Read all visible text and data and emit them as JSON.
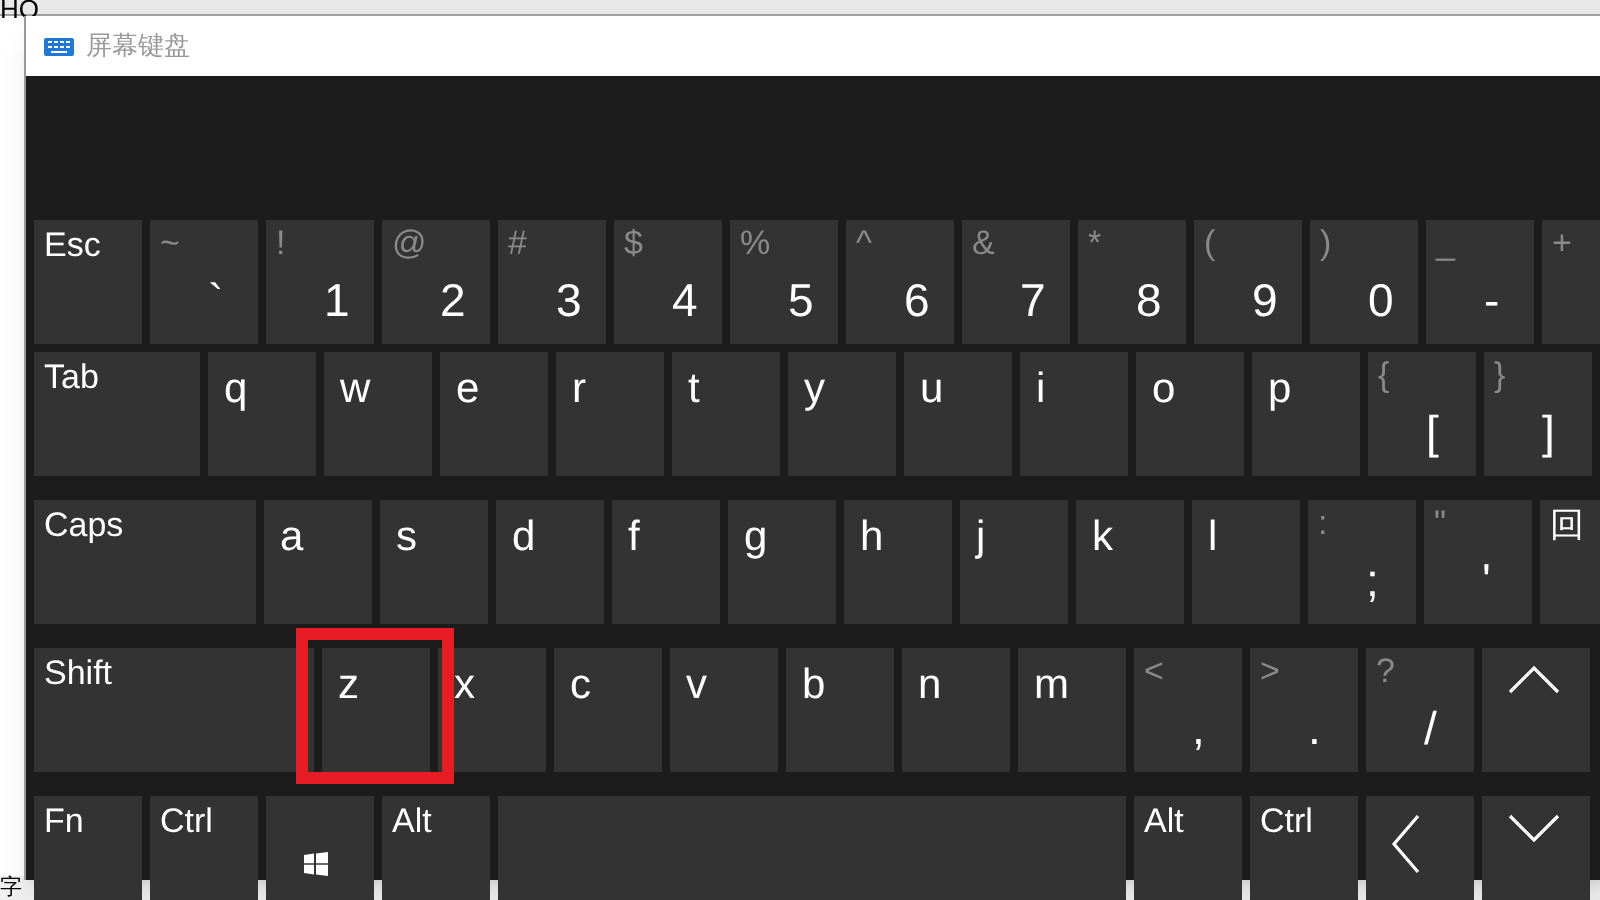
{
  "background": {
    "top_text": "HO",
    "bottom_text": "字"
  },
  "window": {
    "title": "屏幕键盘"
  },
  "rows": [
    {
      "keys": [
        {
          "kind": "mod",
          "label": "Esc"
        },
        {
          "kind": "char",
          "shift": "~",
          "main": "`"
        },
        {
          "kind": "char",
          "shift": "!",
          "main": "1"
        },
        {
          "kind": "char",
          "shift": "@",
          "main": "2"
        },
        {
          "kind": "char",
          "shift": "#",
          "main": "3"
        },
        {
          "kind": "char",
          "shift": "$",
          "main": "4"
        },
        {
          "kind": "char",
          "shift": "%",
          "main": "5"
        },
        {
          "kind": "char",
          "shift": "^",
          "main": "6"
        },
        {
          "kind": "char",
          "shift": "&",
          "main": "7"
        },
        {
          "kind": "char",
          "shift": "*",
          "main": "8"
        },
        {
          "kind": "char",
          "shift": "(",
          "main": "9"
        },
        {
          "kind": "char",
          "shift": ")",
          "main": "0"
        },
        {
          "kind": "char",
          "shift": "_",
          "main": "-"
        },
        {
          "kind": "char",
          "shift": "+"
        }
      ]
    },
    {
      "keys": [
        {
          "kind": "mod",
          "label": "Tab"
        },
        {
          "kind": "letter",
          "label": "q"
        },
        {
          "kind": "letter",
          "label": "w"
        },
        {
          "kind": "letter",
          "label": "e"
        },
        {
          "kind": "letter",
          "label": "r"
        },
        {
          "kind": "letter",
          "label": "t"
        },
        {
          "kind": "letter",
          "label": "y"
        },
        {
          "kind": "letter",
          "label": "u"
        },
        {
          "kind": "letter",
          "label": "i"
        },
        {
          "kind": "letter",
          "label": "o"
        },
        {
          "kind": "letter",
          "label": "p"
        },
        {
          "kind": "char",
          "shift": "{",
          "main": "["
        },
        {
          "kind": "char",
          "shift": "}",
          "main": "]"
        }
      ]
    },
    {
      "keys": [
        {
          "kind": "mod",
          "label": "Caps"
        },
        {
          "kind": "letter",
          "label": "a"
        },
        {
          "kind": "letter",
          "label": "s"
        },
        {
          "kind": "letter",
          "label": "d"
        },
        {
          "kind": "letter",
          "label": "f"
        },
        {
          "kind": "letter",
          "label": "g"
        },
        {
          "kind": "letter",
          "label": "h"
        },
        {
          "kind": "letter",
          "label": "j"
        },
        {
          "kind": "letter",
          "label": "k"
        },
        {
          "kind": "letter",
          "label": "l"
        },
        {
          "kind": "char",
          "shift": ":",
          "main": ";"
        },
        {
          "kind": "char",
          "shift": "\"",
          "main": "'"
        },
        {
          "kind": "mod",
          "label": "回"
        }
      ]
    },
    {
      "keys": [
        {
          "kind": "mod",
          "label": "Shift"
        },
        {
          "kind": "letter",
          "label": "z",
          "highlighted": true
        },
        {
          "kind": "letter",
          "label": "x"
        },
        {
          "kind": "letter",
          "label": "c"
        },
        {
          "kind": "letter",
          "label": "v"
        },
        {
          "kind": "letter",
          "label": "b"
        },
        {
          "kind": "letter",
          "label": "n"
        },
        {
          "kind": "letter",
          "label": "m"
        },
        {
          "kind": "char",
          "shift": "<",
          "main": ","
        },
        {
          "kind": "char",
          "shift": ">",
          "main": "."
        },
        {
          "kind": "char",
          "shift": "?",
          "main": "/"
        },
        {
          "kind": "up_arrow"
        }
      ]
    },
    {
      "keys": [
        {
          "kind": "mod",
          "label": "Fn"
        },
        {
          "kind": "mod",
          "label": "Ctrl"
        },
        {
          "kind": "win"
        },
        {
          "kind": "mod",
          "label": "Alt"
        },
        {
          "kind": "space"
        },
        {
          "kind": "mod",
          "label": "Alt"
        },
        {
          "kind": "mod",
          "label": "Ctrl"
        },
        {
          "kind": "left_arrow"
        },
        {
          "kind": "down_arrow"
        }
      ]
    }
  ]
}
